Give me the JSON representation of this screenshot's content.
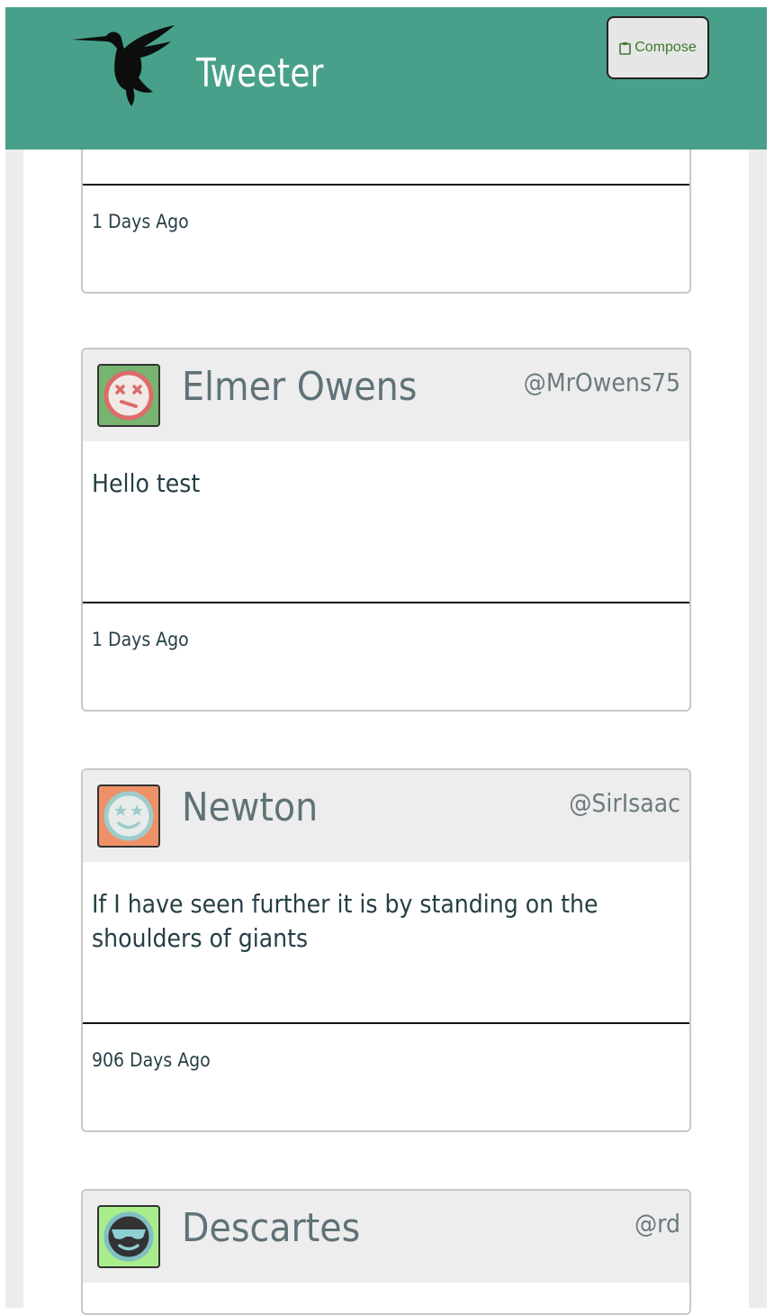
{
  "header": {
    "brand": "Tweeter",
    "compose_label": "Compose",
    "color": "#48a08a"
  },
  "tweets": [
    {
      "time": "1 Days Ago"
    },
    {
      "name": "Elmer Owens",
      "handle": "@MrOwens75",
      "text": "Hello test",
      "time": "1 Days Ago",
      "avatar_bg": "#76b46f",
      "avatar_icon": "dizzy-face-icon"
    },
    {
      "name": "Newton",
      "handle": "@SirIsaac",
      "text": "If I have seen further it is by standing on the shoulders of giants",
      "time": "906 Days Ago",
      "avatar_bg": "#ee9168",
      "avatar_icon": "star-eyes-face-icon"
    },
    {
      "name": "Descartes",
      "handle": "@rd",
      "avatar_bg": "#a8ec8c",
      "avatar_icon": "sunglasses-face-icon"
    }
  ]
}
